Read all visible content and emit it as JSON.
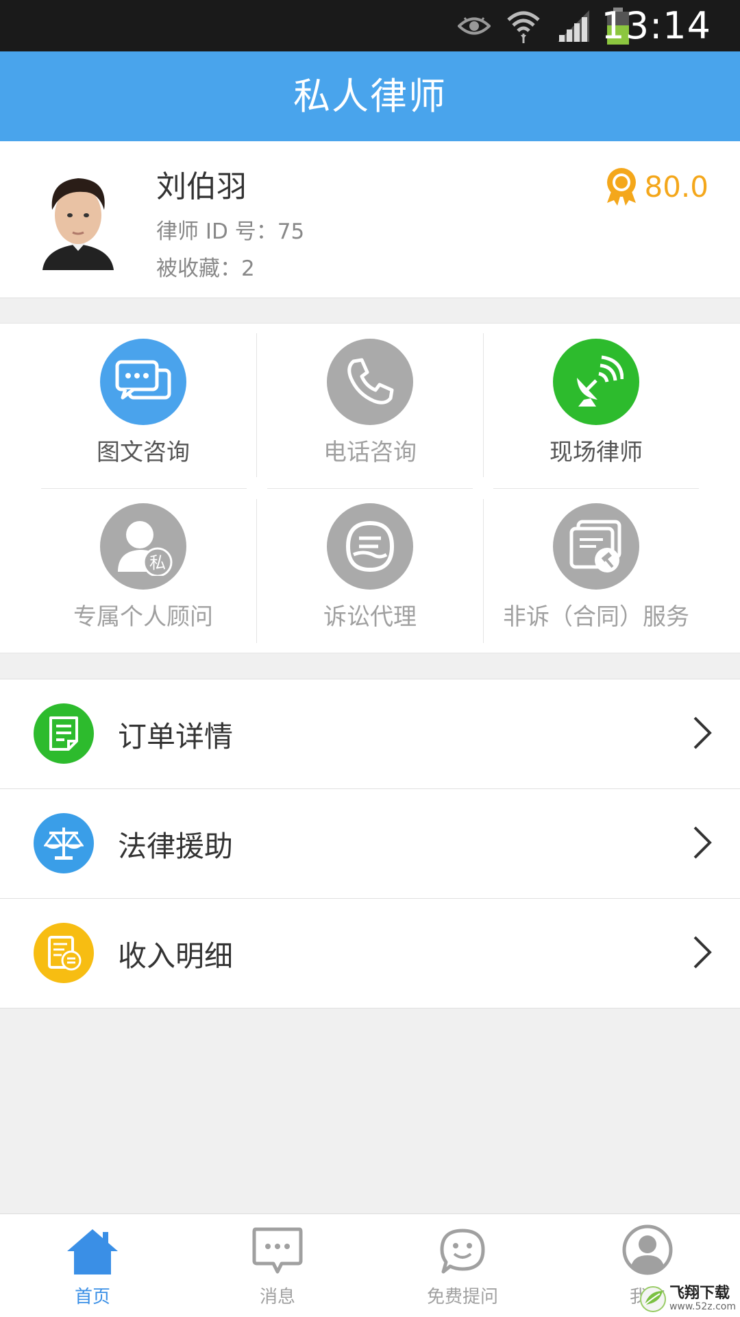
{
  "status_bar": {
    "time": "13:14"
  },
  "header": {
    "title": "私人律师"
  },
  "profile": {
    "name": "刘伯羽",
    "lawyer_id": "律师 ID 号：75",
    "favorites": "被收藏：2",
    "score": "80.0"
  },
  "services": [
    {
      "label": "图文咨询",
      "icon": "chat-bubbles-icon",
      "color": "#4aa3ec",
      "active": true
    },
    {
      "label": "电话咨询",
      "icon": "phone-icon",
      "color": "#aaaaaa",
      "active": false
    },
    {
      "label": "现场律师",
      "icon": "satellite-dish-icon",
      "color": "#2dbb2d",
      "active": true
    },
    {
      "label": "专属个人顾问",
      "icon": "private-advisor-icon",
      "color": "#aaaaaa",
      "active": false
    },
    {
      "label": "诉讼代理",
      "icon": "litigation-icon",
      "color": "#aaaaaa",
      "active": false
    },
    {
      "label": "非诉（合同）服务",
      "icon": "contract-gavel-icon",
      "color": "#aaaaaa",
      "active": false
    }
  ],
  "menu": [
    {
      "label": "订单详情",
      "icon": "document-icon",
      "color": "#2dbb2d"
    },
    {
      "label": "法律援助",
      "icon": "scales-icon",
      "color": "#3a9ee8"
    },
    {
      "label": "收入明细",
      "icon": "income-icon",
      "color": "#f7bd12"
    }
  ],
  "tabs": [
    {
      "label": "首页",
      "icon": "home-icon",
      "active": true
    },
    {
      "label": "消息",
      "icon": "message-icon",
      "active": false
    },
    {
      "label": "免费提问",
      "icon": "smile-chat-icon",
      "active": false
    },
    {
      "label": "我的",
      "icon": "profile-icon",
      "active": false
    }
  ],
  "watermark": {
    "brand": "飞翔下载",
    "url": "www.52z.com"
  },
  "colors": {
    "primary": "#49a4ec",
    "active_text": "#555555",
    "inactive_text": "#a0a0a0",
    "score": "#f4a71b"
  }
}
